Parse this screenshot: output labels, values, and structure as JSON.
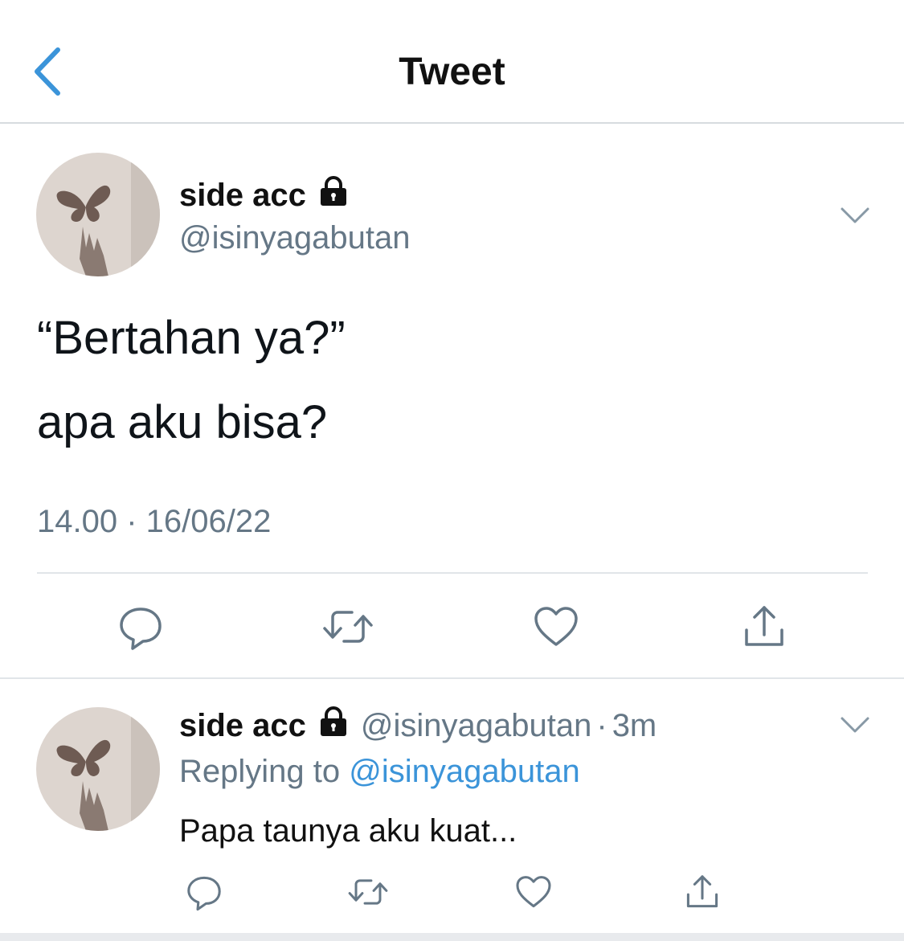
{
  "header": {
    "title": "Tweet",
    "back_icon": "chevron-left-icon",
    "accent_color": "#3b94d9"
  },
  "main_tweet": {
    "display_name": "side acc",
    "protected_icon": "lock-icon",
    "handle": "@isinyagabutan",
    "text_line1": "“Bertahan ya?”",
    "text_line2": "apa aku bisa?",
    "timestamp": "14.00 · 16/06/22",
    "actions": [
      "reply",
      "retweet",
      "like",
      "share"
    ]
  },
  "reply_tweet": {
    "display_name": "side acc",
    "protected_icon": "lock-icon",
    "handle": "@isinyagabutan",
    "separator": "·",
    "time_ago": "3m",
    "replying_prefix": "Replying to",
    "replying_to": "@isinyagabutan",
    "text": "Papa taunya aku kuat...",
    "actions": [
      "reply",
      "retweet",
      "like",
      "share"
    ]
  }
}
